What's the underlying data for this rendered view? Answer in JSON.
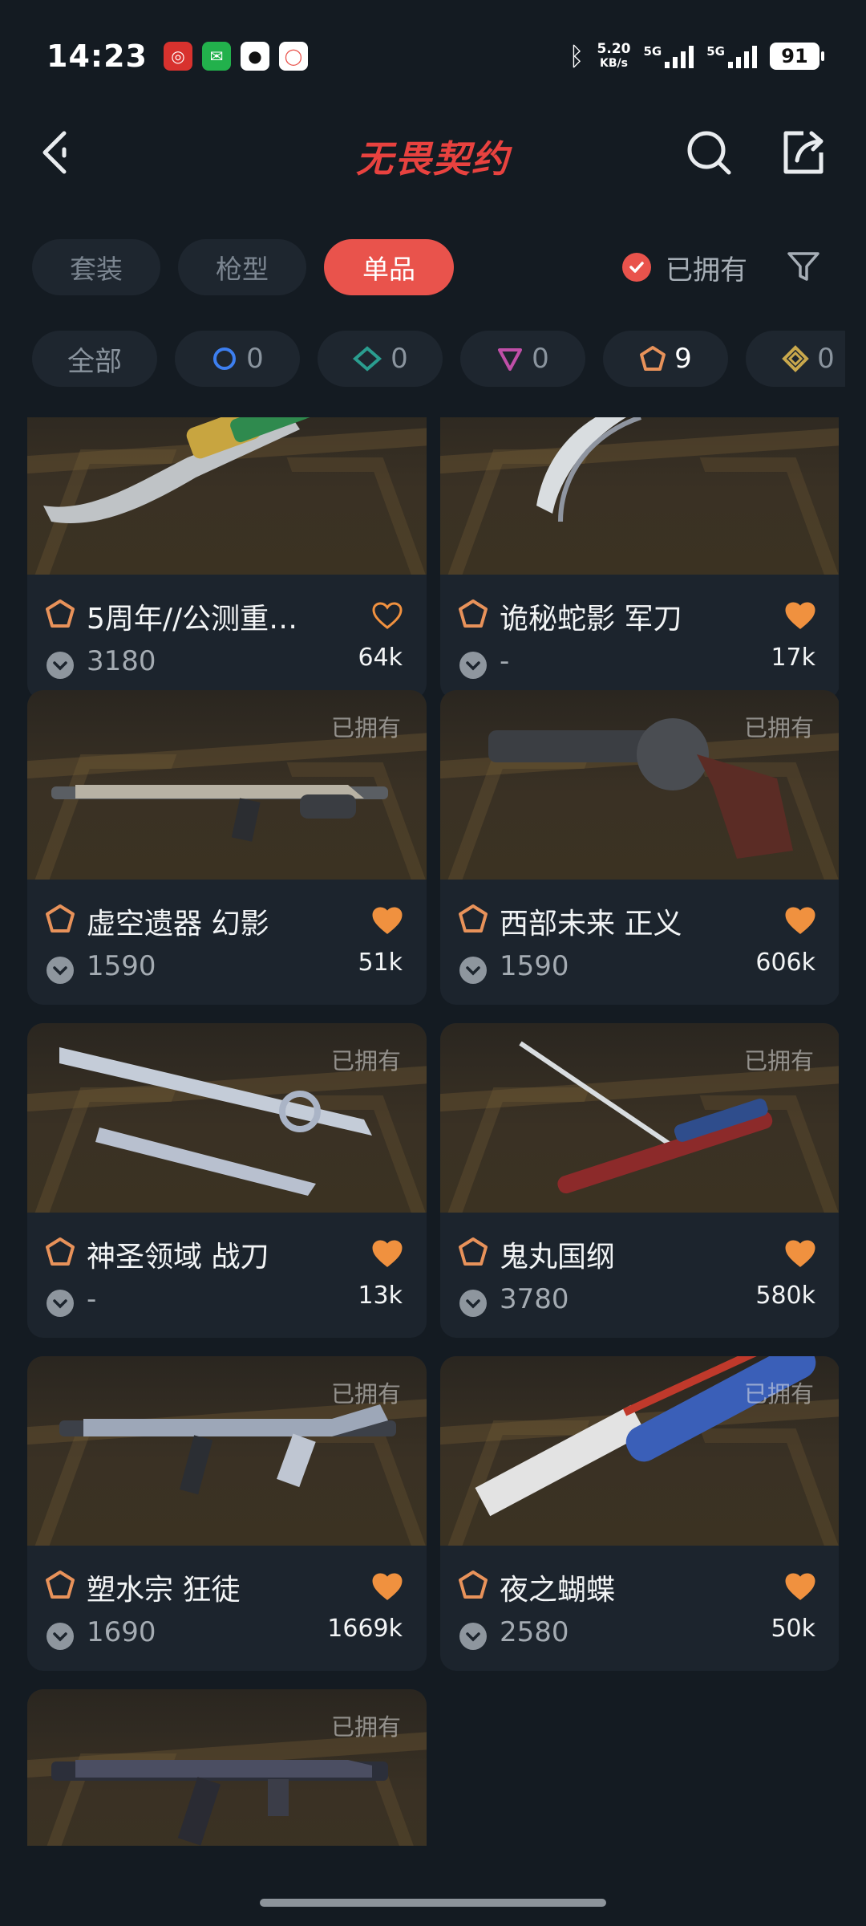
{
  "status_bar": {
    "time": "14:23",
    "net_speed": "5.20",
    "net_unit": "KB/s",
    "sim1": "5G",
    "sim2": "5G",
    "battery": "91"
  },
  "header": {
    "title": "无畏契约"
  },
  "tabs": [
    {
      "label": "套装",
      "active": false
    },
    {
      "label": "枪型",
      "active": false
    },
    {
      "label": "单品",
      "active": true
    }
  ],
  "owned_filter": {
    "label": "已拥有",
    "checked": true
  },
  "tier_chips": [
    {
      "label": "全部",
      "count": ""
    },
    {
      "icon": "select-tier-icon",
      "count": "0",
      "color": "#3d7ff0"
    },
    {
      "icon": "deluxe-tier-icon",
      "count": "0",
      "color": "#2a9d8f"
    },
    {
      "icon": "premium-tier-icon",
      "count": "0",
      "color": "#c04fa8"
    },
    {
      "icon": "exclusive-tier-icon",
      "count": "9",
      "color": "#e8925a"
    },
    {
      "icon": "ultra-tier-icon",
      "count": "0",
      "color": "#c9a84c"
    }
  ],
  "items": [
    {
      "name": "5周年//公测重…",
      "price": "3180",
      "likes": "64k",
      "owned": false,
      "favorited": false,
      "owned_label": ""
    },
    {
      "name": "诡秘蛇影 军刀",
      "price": "-",
      "likes": "17k",
      "owned": false,
      "favorited": true,
      "owned_label": ""
    },
    {
      "name": "虚空遗器 幻影",
      "price": "1590",
      "likes": "51k",
      "owned": true,
      "favorited": true,
      "owned_label": "已拥有"
    },
    {
      "name": "西部未来 正义",
      "price": "1590",
      "likes": "606k",
      "owned": true,
      "favorited": true,
      "owned_label": "已拥有"
    },
    {
      "name": "神圣领域 战刀",
      "price": "-",
      "likes": "13k",
      "owned": true,
      "favorited": true,
      "owned_label": "已拥有"
    },
    {
      "name": "鬼丸国纲",
      "price": "3780",
      "likes": "580k",
      "owned": true,
      "favorited": true,
      "owned_label": "已拥有"
    },
    {
      "name": "塑水宗 狂徒",
      "price": "1690",
      "likes": "1669k",
      "owned": true,
      "favorited": true,
      "owned_label": "已拥有"
    },
    {
      "name": "夜之蝴蝶",
      "price": "2580",
      "likes": "50k",
      "owned": true,
      "favorited": true,
      "owned_label": "已拥有"
    },
    {
      "name": "",
      "price": "",
      "likes": "",
      "owned": true,
      "favorited": false,
      "owned_label": "已拥有"
    }
  ],
  "colors": {
    "accent": "#e9534c",
    "background": "#141b22",
    "card": "#1c242d",
    "heart": "#f0913f",
    "rank": "#e8925a"
  }
}
